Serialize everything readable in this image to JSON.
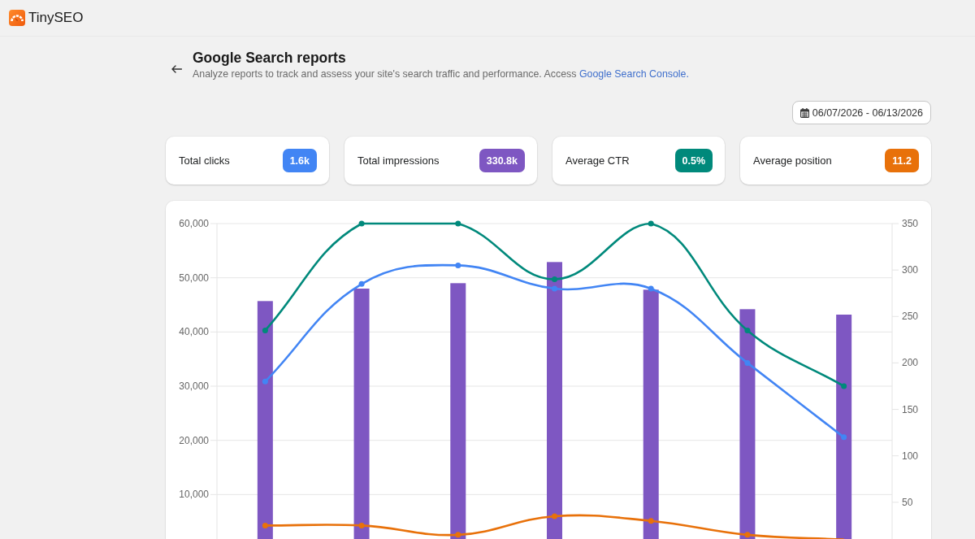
{
  "app": {
    "name": "TinySEO"
  },
  "header": {
    "title": "Google Search reports",
    "subtitle": "Analyze reports to track and assess your site's search traffic and performance. Access",
    "link": "Google Search Console."
  },
  "date_range": {
    "label": "06/07/2026 - 06/13/2026"
  },
  "metrics": [
    {
      "label": "Total clicks",
      "value": "1.6k",
      "color": "#4285f4"
    },
    {
      "label": "Total impressions",
      "value": "330.8k",
      "color": "#7e57c2"
    },
    {
      "label": "Average CTR",
      "value": "0.5%",
      "color": "#00897b"
    },
    {
      "label": "Average position",
      "value": "11.2",
      "color": "#e8710a"
    }
  ],
  "chart": {
    "chart_data": {
      "type": "bar",
      "grid": true,
      "ylim": [
        0,
        60000
      ],
      "yticks": [
        {
          "value": 10000,
          "label": "10,000"
        },
        {
          "value": 20000,
          "label": "20,000"
        },
        {
          "value": 30000,
          "label": "30,000"
        },
        {
          "value": 40000,
          "label": "40,000"
        },
        {
          "value": 50000,
          "label": "50,000"
        },
        {
          "value": 60000,
          "label": "60,000"
        }
      ],
      "y2lim": [
        0,
        350
      ],
      "y2ticks": [
        50,
        100,
        150,
        200,
        250,
        300,
        350
      ],
      "series": [
        {
          "color": "#7e57c2",
          "values": [
            45700,
            48000,
            49000,
            52900,
            47800,
            44200,
            43200
          ]
        },
        {
          "type": "line",
          "axis": "y2",
          "marker": "circle",
          "color": "#00897b",
          "values": [
            235,
            350,
            350,
            290,
            350,
            235,
            175
          ]
        },
        {
          "type": "line",
          "axis": "y2",
          "marker": "circle",
          "color": "#4285f4",
          "values": [
            180,
            285,
            305,
            280,
            280,
            200,
            120
          ]
        },
        {
          "type": "line",
          "axis": "y2",
          "marker": "circle",
          "color": "#e8710a",
          "values": [
            25,
            25,
            15,
            35,
            30,
            15,
            10
          ]
        }
      ]
    }
  }
}
